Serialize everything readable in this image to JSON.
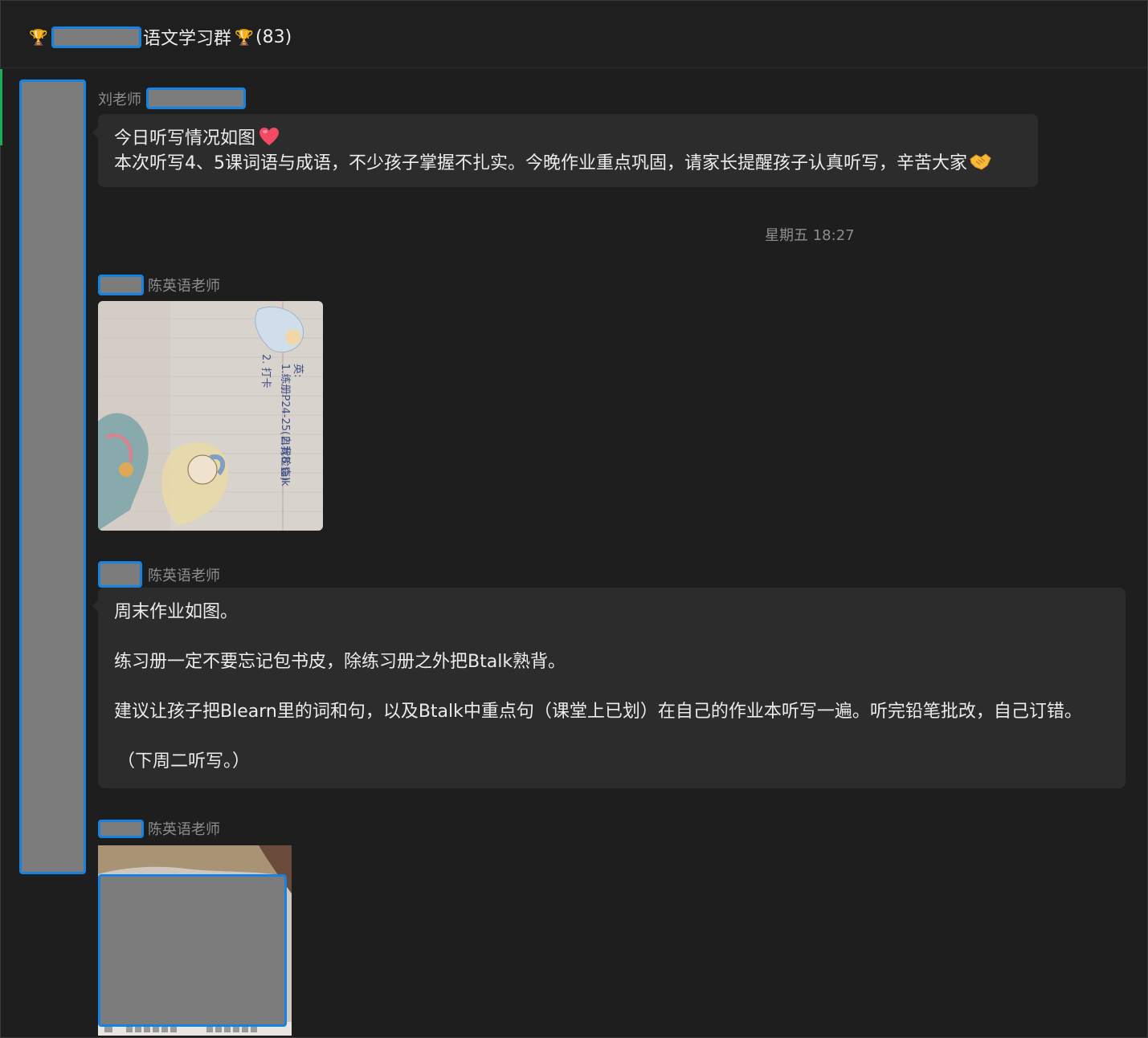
{
  "header": {
    "title_suffix": "语文学习群",
    "member_count": "(83)",
    "icons": [
      "trophy-icon",
      "trophy-icon"
    ]
  },
  "messages": [
    {
      "sender": "刘老师",
      "lines": [
        "今日听写情况如图",
        "本次听写4、5课词语与成语，不少孩子掌握不扎实。今晚作业重点巩固，请家长提醒孩子认真听写，辛苦大家"
      ],
      "emoji": [
        "heart-emoji",
        "handshake-emoji"
      ]
    },
    {
      "timestamp": "星期五 18:27"
    },
    {
      "sender": "陈英语老师",
      "photo_lines": [
        "英:",
        "1.练册P24-25(自我检查)",
        "2.背B talk",
        "2. 打卡"
      ]
    },
    {
      "sender": "陈英语老师",
      "lines": [
        "周末作业如图。",
        "练习册一定不要忘记包书皮，除练习册之外把Btalk熟背。",
        "建议让孩子把Blearn里的词和句，以及Btalk中重点句（课堂上已划）在自己的作业本听写一遍。听完铅笔批改，自己订错。",
        "（下周二听写。）"
      ]
    },
    {
      "sender": "陈英语老师"
    }
  ],
  "colors": {
    "background": "#1e1e1e",
    "bubble": "#2c2c2c",
    "redaction": "#7c7c7c",
    "redaction_border": "#1682e2",
    "active_indicator": "#1aad5b"
  }
}
